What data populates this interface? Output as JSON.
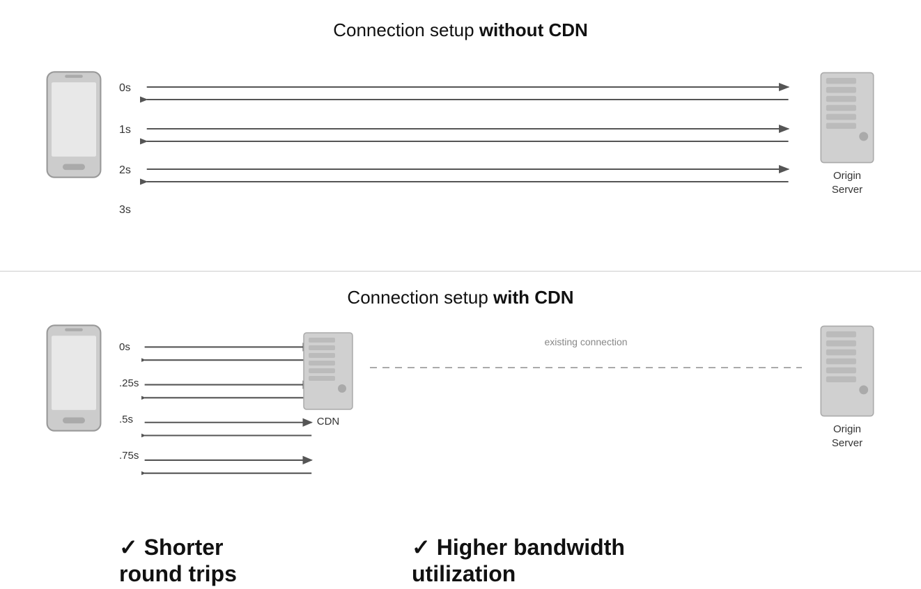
{
  "topSection": {
    "title_normal": "Connection setup ",
    "title_bold": "without CDN",
    "timeLabels": [
      "0s",
      "1s",
      "2s",
      "3s"
    ],
    "serverLabel": "Origin\nServer"
  },
  "bottomSection": {
    "title_normal": "Connection setup ",
    "title_bold": "with CDN",
    "timeLabels": [
      "0s",
      ".25s",
      ".5s",
      ".75s"
    ],
    "cdnLabel": "CDN",
    "serverLabel": "Origin\nServer",
    "existingConnection": "existing connection",
    "benefit1": "✓ Shorter\nround trips",
    "benefit2": "✓ Higher bandwidth\nutilization"
  }
}
